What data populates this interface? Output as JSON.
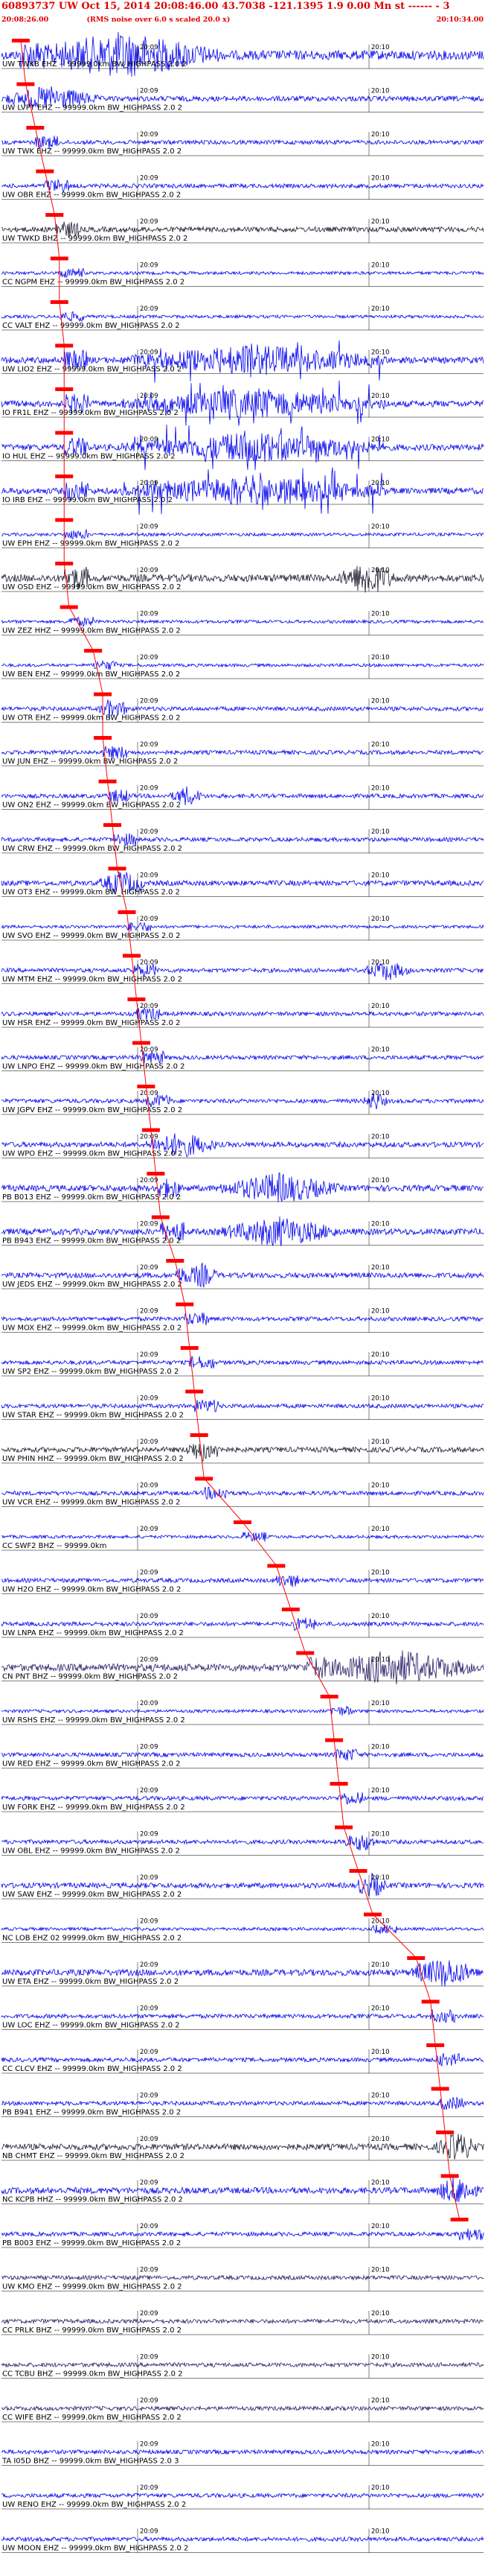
{
  "header": {
    "line1": "60893737  UW  Oct 15, 2014 20:08:46.00     43.7038  -121.1395   1.9  0.00  Mn st ------ - 3",
    "start_time": "20:08:26.00",
    "note": "(RMS noise over 6.0 s scaled 20.0 x)",
    "end_time": "20:10:34.00"
  },
  "minute_labels": [
    "20:09",
    "20:10"
  ],
  "colors": {
    "trace_blue": "#0000ee",
    "trace_dark": "#1a1a2e",
    "trace_purple": "#2a1a66",
    "pick": "#ff0000",
    "baseline": "#000000"
  },
  "traces": [
    {
      "label": "UW TWKB EHZ -- 99999.0km BW_HIGHPASS  2.0  2",
      "color": "blue",
      "amp": 0.9,
      "burst": [
        0.05,
        0.45
      ],
      "pick_t": 0.04
    },
    {
      "label": "UW LVPT EHZ -- 99999.0km BW_HIGHPASS  2.0  2",
      "color": "blue",
      "amp": 0.5,
      "burst": [
        0.0,
        0.2
      ],
      "pick_t": 0.05
    },
    {
      "label": "UW TWK EHZ -- 99999.0km BW_HIGHPASS  2.0  2",
      "color": "blue",
      "amp": 0.4,
      "burst": null,
      "pick_t": 0.07
    },
    {
      "label": "UW OBR EHZ -- 99999.0km BW_HIGHPASS  2.0  2",
      "color": "blue",
      "amp": 0.4,
      "burst": null,
      "pick_t": 0.09
    },
    {
      "label": "UW TWKD BHZ -- 99999.0km BW_HIGHPASS  2.0  2",
      "color": "dark",
      "amp": 0.5,
      "burst": null,
      "pick_t": 0.11
    },
    {
      "label": "CC NGPM EHZ -- 99999.0km BW_HIGHPASS  2.0  2",
      "color": "blue",
      "amp": 0.3,
      "burst": null,
      "pick_t": 0.12
    },
    {
      "label": "CC VALT EHZ -- 99999.0km BW_HIGHPASS  2.0  2",
      "color": "blue",
      "amp": 0.3,
      "burst": null,
      "pick_t": 0.12
    },
    {
      "label": "UW LIO2 EHZ -- 99999.0km BW_HIGHPASS  2.0  2",
      "color": "blue",
      "amp": 0.6,
      "burst": [
        0.25,
        0.8
      ],
      "spiky": true,
      "pick_t": 0.13
    },
    {
      "label": "IO FR1L EHZ -- 99999.0km BW_HIGHPASS  2.0  2",
      "color": "blue",
      "amp": 0.6,
      "burst": [
        0.25,
        0.8
      ],
      "spiky": true,
      "pick_t": 0.13
    },
    {
      "label": "IO HUL EHZ -- 99999.0km BW_HIGHPASS  2.0  2",
      "color": "blue",
      "amp": 0.6,
      "burst": [
        0.25,
        0.8
      ],
      "spiky": true,
      "pick_t": 0.13
    },
    {
      "label": "IO IRB EHZ -- 99999.0km BW_HIGHPASS  2.0  2",
      "color": "blue",
      "amp": 0.6,
      "burst": [
        0.25,
        0.8
      ],
      "spiky": true,
      "pick_t": 0.13
    },
    {
      "label": "UW EPH EHZ -- 99999.0km BW_HIGHPASS  2.0  2",
      "color": "blue",
      "amp": 0.3,
      "burst": null,
      "pick_t": 0.13
    },
    {
      "label": "UW OSD EHZ -- 99999.0km BW_HIGHPASS  2.0  2",
      "color": "dark",
      "amp": 0.7,
      "burst": [
        0.7,
        0.82
      ],
      "pick_t": 0.13
    },
    {
      "label": "UW ZEZ HHZ -- 99999.0km BW_HIGHPASS  2.0  2",
      "color": "blue",
      "amp": 0.3,
      "burst": null,
      "pick_t": 0.14
    },
    {
      "label": "UW BEN EHZ -- 99999.0km BW_HIGHPASS  2.0  2",
      "color": "blue",
      "amp": 0.3,
      "burst": null,
      "pick_t": 0.19
    },
    {
      "label": "UW OTR EHZ -- 99999.0km BW_HIGHPASS  2.0  2",
      "color": "blue",
      "amp": 0.4,
      "burst": [
        0.2,
        0.25
      ],
      "pick_t": 0.21
    },
    {
      "label": "UW JUN EHZ -- 99999.0km BW_HIGHPASS  2.0  2",
      "color": "blue",
      "amp": 0.4,
      "burst": null,
      "pick_t": 0.21
    },
    {
      "label": "UW ON2 EHZ -- 99999.0km BW_HIGHPASS  2.0  2",
      "color": "blue",
      "amp": 0.4,
      "burst": [
        0.35,
        0.42
      ],
      "pick_t": 0.22
    },
    {
      "label": "UW CRW EHZ -- 99999.0km BW_HIGHPASS  2.0  2",
      "color": "blue",
      "amp": 0.4,
      "burst": null,
      "pick_t": 0.23
    },
    {
      "label": "UW OT3 EHZ -- 99999.0km BW_HIGHPASS  2.0  2",
      "color": "blue",
      "amp": 0.5,
      "burst": [
        0.2,
        0.3
      ],
      "pick_t": 0.24
    },
    {
      "label": "UW SVO EHZ -- 99999.0km BW_HIGHPASS  2.0  2",
      "color": "blue",
      "amp": 0.3,
      "burst": null,
      "pick_t": 0.26
    },
    {
      "label": "UW MTM EHZ -- 99999.0km BW_HIGHPASS  2.0  2",
      "color": "blue",
      "amp": 0.4,
      "burst": [
        0.75,
        0.85
      ],
      "pick_t": 0.27
    },
    {
      "label": "UW HSR EHZ -- 99999.0km BW_HIGHPASS  2.0  2",
      "color": "blue",
      "amp": 0.4,
      "burst": null,
      "pick_t": 0.28
    },
    {
      "label": "UW LNPO EHZ -- 99999.0km BW_HIGHPASS  2.0  2",
      "color": "blue",
      "amp": 0.4,
      "burst": null,
      "pick_t": 0.29
    },
    {
      "label": "UW JGPV EHZ -- 99999.0km BW_HIGHPASS  2.0  2",
      "color": "blue",
      "amp": 0.4,
      "burst": [
        0.75,
        0.8
      ],
      "pick_t": 0.3
    },
    {
      "label": "UW WPO EHZ -- 99999.0km BW_HIGHPASS  2.0  2",
      "color": "blue",
      "amp": 0.5,
      "burst": [
        0.3,
        0.45
      ],
      "pick_t": 0.31
    },
    {
      "label": "PB B013 EHZ -- 99999.0km BW_HIGHPASS  2.0  2",
      "color": "blue",
      "amp": 0.6,
      "burst": [
        0.45,
        0.7
      ],
      "pick_t": 0.32
    },
    {
      "label": "PB B943 EHZ -- 99999.0km BW_HIGHPASS  2.0  2",
      "color": "blue",
      "amp": 0.6,
      "burst": [
        0.45,
        0.7
      ],
      "pick_t": 0.33
    },
    {
      "label": "UW JEDS EHZ -- 99999.0km BW_HIGHPASS  2.0  2",
      "color": "blue",
      "amp": 0.5,
      "burst": [
        0.38,
        0.45
      ],
      "pick_t": 0.36
    },
    {
      "label": "UW MOX EHZ -- 99999.0km BW_HIGHPASS  2.0  2",
      "color": "blue",
      "amp": 0.4,
      "burst": null,
      "pick_t": 0.38
    },
    {
      "label": "UW SP2 EHZ -- 99999.0km BW_HIGHPASS  2.0  2",
      "color": "blue",
      "amp": 0.4,
      "burst": null,
      "pick_t": 0.39
    },
    {
      "label": "UW STAR EHZ -- 99999.0km BW_HIGHPASS  2.0  2",
      "color": "blue",
      "amp": 0.4,
      "burst": null,
      "pick_t": 0.4
    },
    {
      "label": "UW PHIN HHZ -- 99999.0km BW_HIGHPASS  2.0  2",
      "color": "dark",
      "amp": 0.5,
      "burst": [
        0.38,
        0.45
      ],
      "pick_t": 0.41
    },
    {
      "label": "UW VCR EHZ -- 99999.0km BW_HIGHPASS  2.0  2",
      "color": "blue",
      "amp": 0.4,
      "burst": null,
      "pick_t": 0.42
    },
    {
      "label": "CC SWF2 BHZ -- 99999.0km",
      "color": "blue",
      "amp": 0.3,
      "burst": null,
      "pick_t": 0.5
    },
    {
      "label": "UW H2O EHZ -- 99999.0km BW_HIGHPASS  2.0  2",
      "color": "blue",
      "amp": 0.4,
      "burst": null,
      "pick_t": 0.57
    },
    {
      "label": "UW LNPA EHZ -- 99999.0km BW_HIGHPASS  2.0  2",
      "color": "blue",
      "amp": 0.4,
      "burst": null,
      "pick_t": 0.6
    },
    {
      "label": "CN PNT BHZ -- 99999.0km BW_HIGHPASS  2.0  2",
      "color": "purple",
      "amp": 0.7,
      "burst": [
        0.65,
        0.98
      ],
      "pick_t": 0.63
    },
    {
      "label": "UW RSHS EHZ -- 99999.0km BW_HIGHPASS  2.0  2",
      "color": "blue",
      "amp": 0.3,
      "burst": null,
      "pick_t": 0.68
    },
    {
      "label": "UW RED EHZ -- 99999.0km BW_HIGHPASS  2.0  2",
      "color": "blue",
      "amp": 0.4,
      "burst": null,
      "pick_t": 0.69
    },
    {
      "label": "UW FORK EHZ -- 99999.0km BW_HIGHPASS  2.0  2",
      "color": "blue",
      "amp": 0.4,
      "burst": null,
      "pick_t": 0.7
    },
    {
      "label": "UW OBL EHZ -- 99999.0km BW_HIGHPASS  2.0  2",
      "color": "blue",
      "amp": 0.4,
      "burst": [
        0.72,
        0.78
      ],
      "pick_t": 0.71
    },
    {
      "label": "UW SAW EHZ -- 99999.0km BW_HIGHPASS  2.0  2",
      "color": "blue",
      "amp": 0.5,
      "burst": [
        0.74,
        0.8
      ],
      "pick_t": 0.74
    },
    {
      "label": "NC LOB EHZ 02 99999.0km BW_HIGHPASS  2.0  2",
      "color": "blue",
      "amp": 0.3,
      "burst": null,
      "pick_t": 0.77
    },
    {
      "label": "UW ETA EHZ -- 99999.0km BW_HIGHPASS  2.0  2",
      "color": "blue",
      "amp": 0.6,
      "burst": [
        0.85,
        0.99
      ],
      "pick_t": 0.86
    },
    {
      "label": "UW LOC EHZ -- 99999.0km BW_HIGHPASS  2.0  2",
      "color": "blue",
      "amp": 0.4,
      "burst": null,
      "pick_t": 0.89
    },
    {
      "label": "CC CLCV EHZ -- 99999.0km BW_HIGHPASS  2.0  2",
      "color": "blue",
      "amp": 0.4,
      "burst": null,
      "pick_t": 0.9
    },
    {
      "label": "PB B941 EHZ -- 99999.0km BW_HIGHPASS  2.0  2",
      "color": "blue",
      "amp": 0.4,
      "burst": null,
      "pick_t": 0.91
    },
    {
      "label": "NB CHMT EHZ -- 99999.0km BW_HIGHPASS  2.0  2",
      "color": "dark",
      "amp": 0.6,
      "burst": [
        0.9,
        0.99
      ],
      "pick_t": 0.92
    },
    {
      "label": "NC KCPB HHZ -- 99999.0km BW_HIGHPASS  2.0  2",
      "color": "blue",
      "amp": 0.6,
      "burst": [
        0.9,
        0.99
      ],
      "pick_t": 0.93
    },
    {
      "label": "PB B003 EHZ -- 99999.0km BW_HIGHPASS  2.0  2",
      "color": "blue",
      "amp": 0.4,
      "burst": null,
      "pick_t": 0.95
    },
    {
      "label": "UW KMO EHZ -- 99999.0km BW_HIGHPASS  2.0  2",
      "color": "purple",
      "amp": 0.4,
      "burst": null,
      "pick_t": null
    },
    {
      "label": "CC PRLK BHZ -- 99999.0km BW_HIGHPASS  2.0  2",
      "color": "purple",
      "amp": 0.4,
      "burst": null,
      "pick_t": null
    },
    {
      "label": "CC TCBU BHZ -- 99999.0km BW_HIGHPASS  2.0  2",
      "color": "purple",
      "amp": 0.4,
      "burst": null,
      "pick_t": null
    },
    {
      "label": "CC WIFE BHZ -- 99999.0km BW_HIGHPASS  2.0  2",
      "color": "purple",
      "amp": 0.4,
      "burst": null,
      "pick_t": null
    },
    {
      "label": "TA I05D BHZ -- 99999.0km BW_HIGHPASS  2.0  3",
      "color": "blue",
      "amp": 0.4,
      "burst": null,
      "pick_t": null
    },
    {
      "label": "UW RENO EHZ -- 99999.0km BW_HIGHPASS  2.0  2",
      "color": "blue",
      "amp": 0.4,
      "burst": null,
      "pick_t": null
    },
    {
      "label": "UW MOON EHZ -- 99999.0km BW_HIGHPASS  2.0  2",
      "color": "blue",
      "amp": 0.4,
      "burst": null,
      "pick_t": null
    }
  ]
}
